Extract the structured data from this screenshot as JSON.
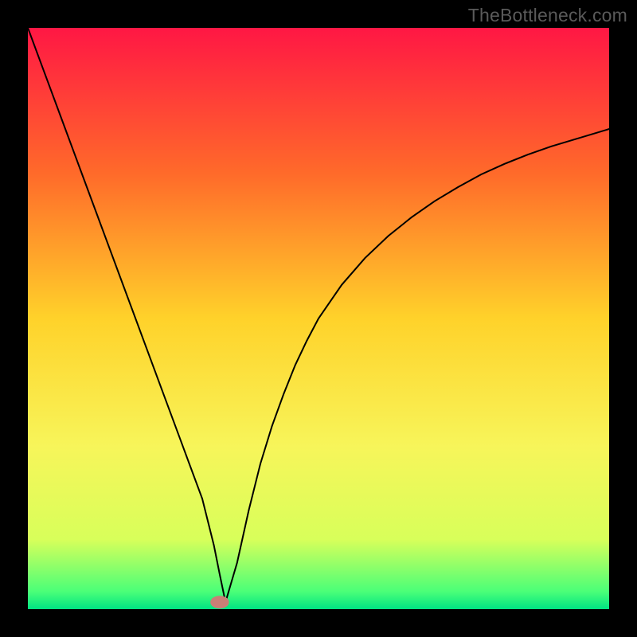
{
  "watermark": "TheBottleneck.com",
  "chart_data": {
    "type": "line",
    "title": "",
    "xlabel": "",
    "ylabel": "",
    "xlim": [
      0,
      100
    ],
    "ylim": [
      0,
      100
    ],
    "gradient_stops": [
      {
        "offset": 0,
        "color": "#ff1744"
      },
      {
        "offset": 25,
        "color": "#ff6a2a"
      },
      {
        "offset": 50,
        "color": "#ffd22a"
      },
      {
        "offset": 72,
        "color": "#f7f55a"
      },
      {
        "offset": 88,
        "color": "#d8ff5a"
      },
      {
        "offset": 97,
        "color": "#4aff78"
      },
      {
        "offset": 100,
        "color": "#00e383"
      }
    ],
    "curve": {
      "x": [
        0,
        2,
        4,
        6,
        8,
        10,
        12,
        14,
        16,
        18,
        20,
        22,
        24,
        26,
        28,
        30,
        31,
        32,
        33,
        34,
        36,
        38,
        40,
        42,
        44,
        46,
        48,
        50,
        54,
        58,
        62,
        66,
        70,
        74,
        78,
        82,
        86,
        90,
        94,
        98,
        100
      ],
      "y": [
        100,
        94.6,
        89.2,
        83.8,
        78.4,
        73,
        67.6,
        62.2,
        56.8,
        51.4,
        46,
        40.6,
        35.2,
        29.8,
        24.4,
        19,
        15,
        11,
        6,
        1.2,
        8,
        17,
        25,
        31.5,
        37,
        42,
        46.2,
        50,
        55.8,
        60.4,
        64.2,
        67.4,
        70.2,
        72.6,
        74.8,
        76.6,
        78.2,
        79.6,
        80.8,
        82,
        82.6
      ]
    },
    "marker": {
      "x": 33,
      "y": 1.2,
      "rx": 1.6,
      "ry": 1.1,
      "color": "#c97f76"
    }
  }
}
